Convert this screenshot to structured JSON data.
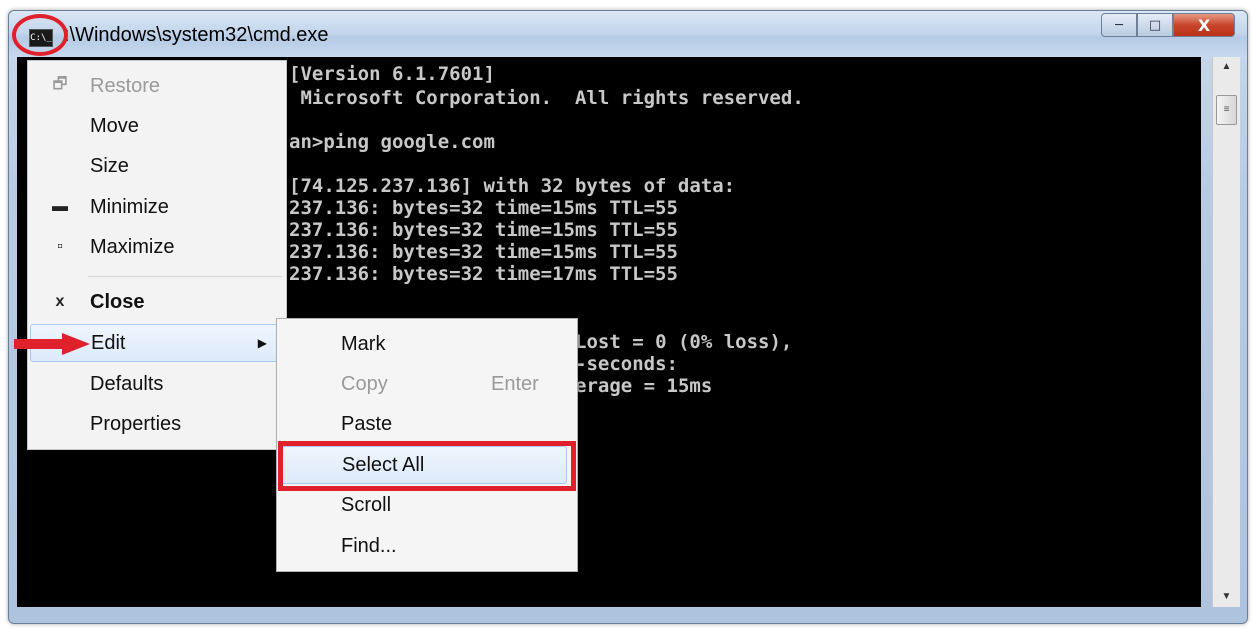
{
  "window": {
    "title": ":\\Windows\\system32\\cmd.exe",
    "icon_text": "C:\\_"
  },
  "caption_buttons": {
    "minimize": "─",
    "maximize": "□",
    "close": "X"
  },
  "console_lines": [
    "[Version 6.1.7601]",
    " Microsoft Corporation.  All rights reserved.",
    "an>ping google.com",
    "[74.125.237.136] with 32 bytes of data:",
    "237.136: bytes=32 time=15ms TTL=55",
    "237.136: bytes=32 time=15ms TTL=55",
    "237.136: bytes=32 time=15ms TTL=55",
    "237.136: bytes=32 time=17ms TTL=55",
    "Lost = 0 (0% loss),",
    "-seconds:",
    "erage = 15ms"
  ],
  "system_menu": {
    "items": [
      {
        "label": "Restore",
        "glyph": "🗗",
        "disabled": true
      },
      {
        "label": "Move",
        "glyph": ""
      },
      {
        "label": "Size",
        "glyph": ""
      },
      {
        "label": "Minimize",
        "glyph": "▬"
      },
      {
        "label": "Maximize",
        "glyph": "▫"
      },
      {
        "label": "Close",
        "glyph": "x"
      },
      {
        "label": "Edit",
        "glyph": "",
        "arrow": "▶"
      },
      {
        "label": "Defaults",
        "glyph": ""
      },
      {
        "label": "Properties",
        "glyph": ""
      }
    ]
  },
  "edit_submenu": {
    "items": [
      {
        "label": "Mark",
        "shortcut": ""
      },
      {
        "label": "Copy",
        "shortcut": "Enter",
        "disabled": true
      },
      {
        "label": "Paste",
        "shortcut": ""
      },
      {
        "label": "Select All",
        "shortcut": ""
      },
      {
        "label": "Scroll",
        "shortcut": ""
      },
      {
        "label": "Find...",
        "shortcut": ""
      }
    ]
  },
  "colors": {
    "annotation": "#e0202a",
    "console_bg": "#000000",
    "console_fg": "#c8c8c8",
    "menu_hover": "#ddeafa"
  }
}
